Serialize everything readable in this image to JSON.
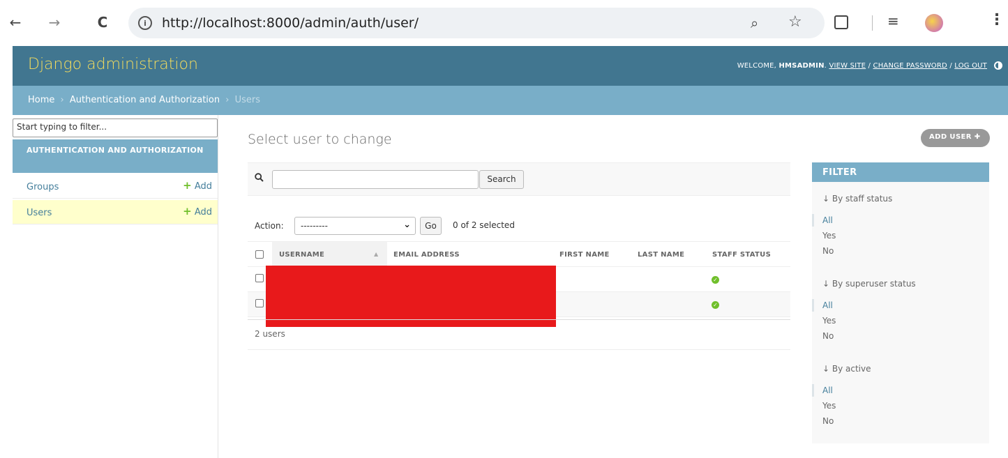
{
  "browser": {
    "url": "http://localhost:8000/admin/auth/user/",
    "back_glyph": "←",
    "forward_glyph": "→",
    "reload_glyph": "C",
    "info_glyph": "i",
    "zoom_glyph": "⌕",
    "star_glyph": "☆",
    "reading_glyph": "≡",
    "more_glyph": "⋮",
    "icons": [
      "back-icon",
      "forward-icon",
      "reload-icon",
      "site-info-icon",
      "zoom-icon",
      "bookmark-star-icon",
      "extensions-icon",
      "reading-list-icon",
      "profile-avatar",
      "more-icon"
    ]
  },
  "header": {
    "site_name": "Django administration",
    "welcome": "WELCOME,",
    "username": "HMSADMIN",
    "view_site": "VIEW SITE",
    "change_password": "CHANGE PASSWORD",
    "log_out": "LOG OUT",
    "sep": "/",
    "period": ".",
    "colors": {
      "header_bg": "#417690",
      "site_name": "#f5dd5d",
      "breadcrumbs_bg": "#79aec8"
    }
  },
  "breadcrumbs": {
    "home": "Home",
    "app": "Authentication and Authorization",
    "current": "Users",
    "sep": "›"
  },
  "sidebar": {
    "filter_placeholder": "Start typing to filter...",
    "app_caption": "AUTHENTICATION AND AUTHORIZATION",
    "plus": "+",
    "models": [
      {
        "name": "Groups",
        "add": "Add"
      },
      {
        "name": "Users",
        "add": "Add"
      }
    ]
  },
  "content": {
    "title": "Select user to change",
    "add_user": "ADD USER",
    "add_glyph": "✚",
    "search_button": "Search",
    "search_value": "",
    "action_label": "Action:",
    "action_selected": "---------",
    "action_chevron": "⌄",
    "go_button": "Go",
    "selected_count": "0 of 2 selected",
    "columns": [
      "USERNAME",
      "EMAIL ADDRESS",
      "FIRST NAME",
      "LAST NAME",
      "STAFF STATUS"
    ],
    "sort_caret": "▲",
    "status_glyph": "✓",
    "rows": [
      {
        "staff_status": "yes"
      },
      {
        "staff_status": "yes"
      }
    ],
    "result_count": "2 users"
  },
  "filter": {
    "title": "FILTER",
    "groups": [
      {
        "title": "↓ By staff status",
        "options": [
          "All",
          "Yes",
          "No"
        ]
      },
      {
        "title": "↓ By superuser status",
        "options": [
          "All",
          "Yes",
          "No"
        ]
      },
      {
        "title": "↓ By active",
        "options": [
          "All",
          "Yes",
          "No"
        ]
      }
    ]
  }
}
